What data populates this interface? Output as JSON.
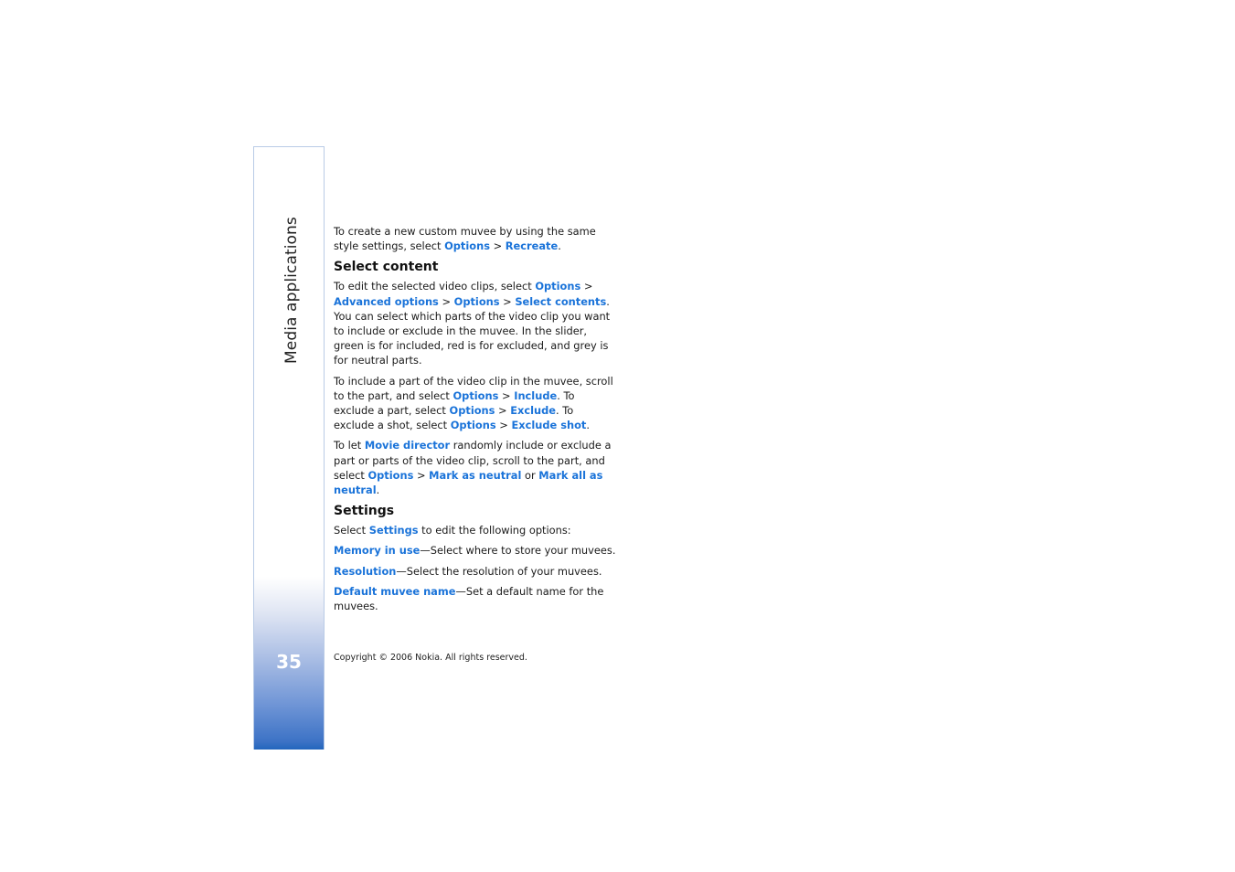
{
  "sidebar": {
    "section_title": "Media applications",
    "page_number": "35"
  },
  "content": {
    "blocks": [
      {
        "type": "p",
        "runs": [
          {
            "t": "To create a new custom muvee by using the same style settings, select "
          },
          {
            "t": "Options",
            "link": true
          },
          {
            "t": " > "
          },
          {
            "t": "Recreate",
            "link": true
          },
          {
            "t": "."
          }
        ]
      },
      {
        "type": "h2",
        "text": "Select content"
      },
      {
        "type": "p",
        "runs": [
          {
            "t": "To edit the selected video clips, select "
          },
          {
            "t": "Options",
            "link": true
          },
          {
            "t": " > "
          },
          {
            "t": "Advanced options",
            "link": true
          },
          {
            "t": " > "
          },
          {
            "t": "Options",
            "link": true
          },
          {
            "t": " > "
          },
          {
            "t": "Select contents",
            "link": true
          },
          {
            "t": ". You can select which parts of the video clip you want to include or exclude in the muvee. In the slider, green is for included, red is for excluded, and grey is for neutral parts."
          }
        ]
      },
      {
        "type": "p",
        "runs": [
          {
            "t": "To include a part of the video clip in the muvee, scroll to the part, and select "
          },
          {
            "t": "Options",
            "link": true
          },
          {
            "t": " > "
          },
          {
            "t": "Include",
            "link": true
          },
          {
            "t": ". To exclude a part, select "
          },
          {
            "t": "Options",
            "link": true
          },
          {
            "t": " > "
          },
          {
            "t": "Exclude",
            "link": true
          },
          {
            "t": ". To exclude a shot, select "
          },
          {
            "t": "Options",
            "link": true
          },
          {
            "t": " > "
          },
          {
            "t": "Exclude shot",
            "link": true
          },
          {
            "t": "."
          }
        ]
      },
      {
        "type": "p",
        "runs": [
          {
            "t": "To let "
          },
          {
            "t": "Movie director",
            "link": true
          },
          {
            "t": " randomly include or exclude a part or parts of the video clip, scroll to the part, and select "
          },
          {
            "t": "Options",
            "link": true
          },
          {
            "t": " > "
          },
          {
            "t": "Mark as neutral",
            "link": true
          },
          {
            "t": " or "
          },
          {
            "t": "Mark all as neutral",
            "link": true
          },
          {
            "t": "."
          }
        ]
      },
      {
        "type": "h2",
        "text": "Settings"
      },
      {
        "type": "p",
        "runs": [
          {
            "t": "Select "
          },
          {
            "t": "Settings",
            "link": true
          },
          {
            "t": " to edit the following options:"
          }
        ]
      },
      {
        "type": "p",
        "runs": [
          {
            "t": "Memory in use",
            "link": true
          },
          {
            "t": "—Select where to store your muvees."
          }
        ]
      },
      {
        "type": "p",
        "runs": [
          {
            "t": "Resolution",
            "link": true
          },
          {
            "t": "—Select the resolution of your muvees."
          }
        ]
      },
      {
        "type": "p",
        "runs": [
          {
            "t": "Default muvee name",
            "link": true
          },
          {
            "t": "—Set a default name for the muvees."
          }
        ]
      }
    ]
  },
  "footer": {
    "copyright": "Copyright © 2006 Nokia. All rights reserved."
  },
  "colors": {
    "link": "#1a73d9",
    "sidebar_bottom": "#2366bd"
  }
}
